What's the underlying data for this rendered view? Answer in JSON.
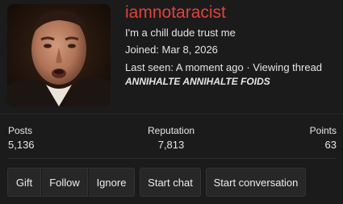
{
  "profile": {
    "username": "iamnotaracist",
    "tagline": "I'm a chill dude trust me",
    "joined": "Joined: Mar 8, 2026",
    "last_seen": "Last seen: A moment ago · Viewing thread",
    "thread_title": "ANNIHALTE ANNIHALTE FOIDS",
    "username_color": "#e0433c"
  },
  "stats": {
    "posts_label": "Posts",
    "posts_value": "5,136",
    "reputation_label": "Reputation",
    "reputation_value": "7,813",
    "points_label": "Points",
    "points_value": "63"
  },
  "actions": {
    "gift": "Gift",
    "follow": "Follow",
    "ignore": "Ignore",
    "start_chat": "Start chat",
    "start_conversation": "Start conversation"
  }
}
